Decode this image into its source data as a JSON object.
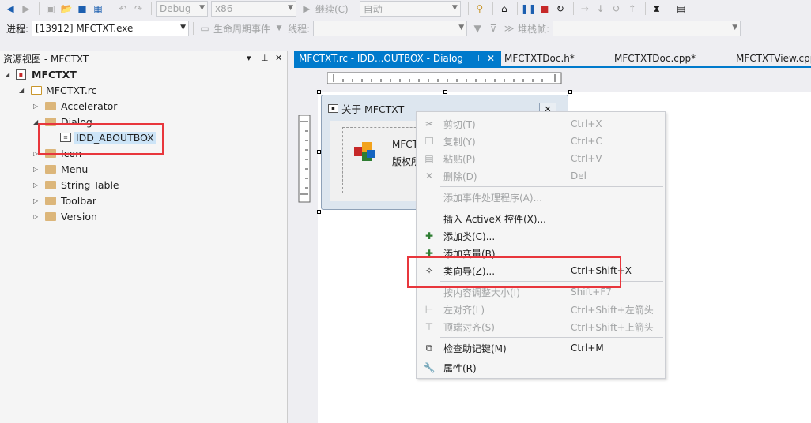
{
  "toolbar1": {
    "config": "Debug",
    "platform": "x86",
    "continue_label": "继续(C)",
    "auto_label": "自动"
  },
  "toolbar2": {
    "process_label": "进程:",
    "process_value": "[13912] MFCTXT.exe",
    "lifecycle_label": "生命周期事件",
    "thread_label": "线程:",
    "stackframe_label": "堆栈帧:"
  },
  "resource_view": {
    "title": "资源视图 - MFCTXT",
    "tree": [
      {
        "label": "MFCTXT",
        "bold": true
      },
      {
        "label": "MFCTXT.rc"
      },
      {
        "label": "Accelerator"
      },
      {
        "label": "Dialog"
      },
      {
        "label": "IDD_ABOUTBOX",
        "selected": true
      },
      {
        "label": "Icon"
      },
      {
        "label": "Menu"
      },
      {
        "label": "String Table"
      },
      {
        "label": "Toolbar"
      },
      {
        "label": "Version"
      }
    ]
  },
  "tabs": [
    {
      "label": "MFCTXT.rc - IDD...OUTBOX - Dialog",
      "active": true
    },
    {
      "label": "MFCTXTDoc.h*"
    },
    {
      "label": "MFCTXTDoc.cpp*"
    },
    {
      "label": "MFCTXTView.cpp"
    }
  ],
  "dialog_preview": {
    "caption": "关于 MFCTXT",
    "line1": "MFCTX",
    "line2": "版权所"
  },
  "context_menu": {
    "items": [
      {
        "label": "剪切(T)",
        "shortcut": "Ctrl+X",
        "disabled": true,
        "icon": "scissors-icon"
      },
      {
        "label": "复制(Y)",
        "shortcut": "Ctrl+C",
        "disabled": true,
        "icon": "copy-icon"
      },
      {
        "label": "粘贴(P)",
        "shortcut": "Ctrl+V",
        "disabled": true,
        "icon": "paste-icon"
      },
      {
        "label": "删除(D)",
        "shortcut": "Del",
        "disabled": true,
        "icon": "delete-icon"
      },
      {
        "label": "添加事件处理程序(A)...",
        "shortcut": "",
        "disabled": true
      },
      {
        "label": "插入 ActiveX 控件(X)...",
        "shortcut": "",
        "disabled": false
      },
      {
        "label": "添加类(C)...",
        "shortcut": "",
        "disabled": false,
        "icon": "add-class-icon"
      },
      {
        "label": "添加变量(B)...",
        "shortcut": "",
        "disabled": false,
        "icon": "add-variable-icon"
      },
      {
        "label": "类向导(Z)...",
        "shortcut": "Ctrl+Shift+X",
        "disabled": false,
        "icon": "class-wizard-icon"
      },
      {
        "label": "按内容调整大小(I)",
        "shortcut": "Shift+F7",
        "disabled": true
      },
      {
        "label": "左对齐(L)",
        "shortcut": "Ctrl+Shift+左箭头",
        "disabled": true,
        "icon": "align-left-icon"
      },
      {
        "label": "顶端对齐(S)",
        "shortcut": "Ctrl+Shift+上箭头",
        "disabled": true,
        "icon": "align-top-icon"
      },
      {
        "label": "检查助记键(M)",
        "shortcut": "Ctrl+M",
        "disabled": false,
        "icon": "check-mnemonics-icon"
      },
      {
        "label": "属性(R)",
        "shortcut": "",
        "disabled": false,
        "icon": "wrench-icon"
      }
    ]
  },
  "colors": {
    "accent": "#007acc",
    "highlight_box": "#e8363c"
  }
}
